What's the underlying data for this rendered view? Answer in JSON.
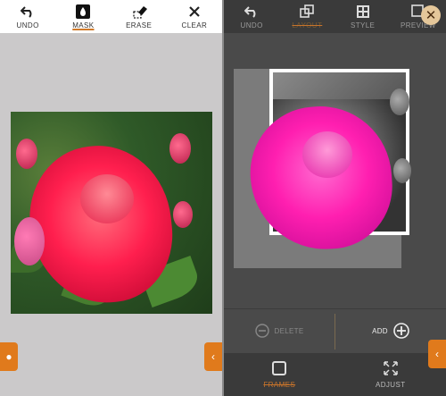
{
  "left": {
    "toolbar": [
      {
        "label": "UNDO",
        "icon": "undo-icon",
        "active": false
      },
      {
        "label": "MASK",
        "icon": "mask-drop-icon",
        "active": true
      },
      {
        "label": "ERASE",
        "icon": "eraser-icon",
        "active": false
      },
      {
        "label": "CLEAR",
        "icon": "close-icon",
        "active": false
      }
    ]
  },
  "right": {
    "toolbar": [
      {
        "label": "UNDO",
        "icon": "undo-icon",
        "active": false
      },
      {
        "label": "LAYOUT",
        "icon": "layout-icon",
        "active": true
      },
      {
        "label": "STYLE",
        "icon": "style-grid-icon",
        "active": false
      },
      {
        "label": "PREVIEW",
        "icon": "preview-icon",
        "active": false
      }
    ],
    "actions": {
      "delete_label": "DELETE",
      "add_label": "ADD"
    },
    "bottom": [
      {
        "label": "FRAMES",
        "icon": "frame-icon",
        "active": true
      },
      {
        "label": "ADJUST",
        "icon": "expand-arrows-icon",
        "active": false
      }
    ]
  },
  "colors": {
    "accent": "#e07a1c",
    "rose": "#ff1f4e"
  }
}
